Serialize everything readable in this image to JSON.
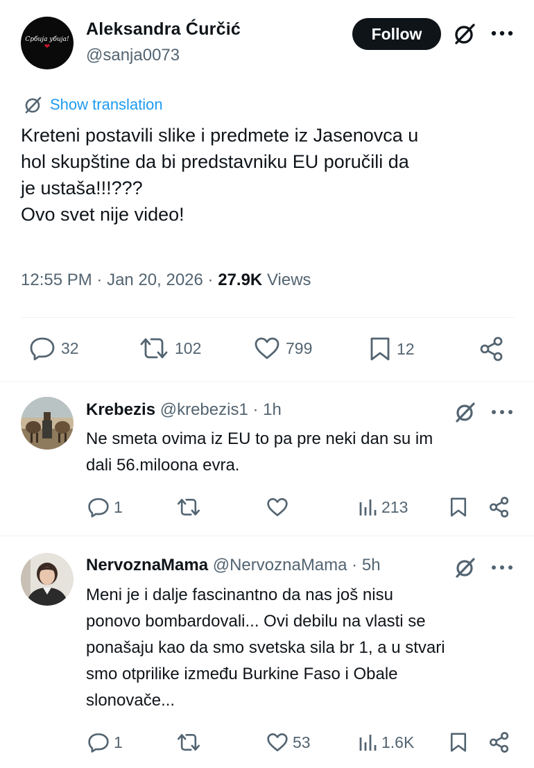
{
  "main_tweet": {
    "author_name": "Aleksandra Ćurčić",
    "author_handle": "@sanja0073",
    "avatar_text": "Србија убија!",
    "follow_label": "Follow",
    "translation_label": "Show translation",
    "text_lines": [
      "Kreteni postavili slike i predmete iz Jasenovca u",
      "hol skupštine da bi predstavniku EU poručili da",
      "je ustaša!!!???",
      "Ovo svet nije video!"
    ],
    "time": "12:55 PM",
    "date": "Jan 20, 2026",
    "views_count": "27.9K",
    "views_label": "Views",
    "replies": "32",
    "reposts": "102",
    "likes": "799",
    "bookmarks": "12"
  },
  "replies": [
    {
      "name": "Krebezis",
      "handle": "@krebezis1",
      "age": "1h",
      "text_lines": [
        "Ne smeta ovima iz EU to pa pre neki dan su im",
        "dali 56.miloona evra."
      ],
      "replies": "1",
      "reposts": "",
      "likes": "",
      "views": "213"
    },
    {
      "name": "NervoznaMama",
      "handle": "@NervoznaMama",
      "age": "5h",
      "text_lines": [
        "Meni je i dalje fascinantno da nas još nisu",
        "ponovo bombardovali... Ovi debilu na vlasti se",
        "ponašaju kao da smo svetska sila br 1, a u stvari",
        "smo otprilike između Burkine Faso i Obale",
        "slonovače..."
      ],
      "replies": "1",
      "reposts": "",
      "likes": "53",
      "views": "1.6K"
    }
  ],
  "colors": {
    "text": "#0f1419",
    "secondary": "#536471",
    "link": "#1d9bf0",
    "divider": "#eff3f4"
  }
}
